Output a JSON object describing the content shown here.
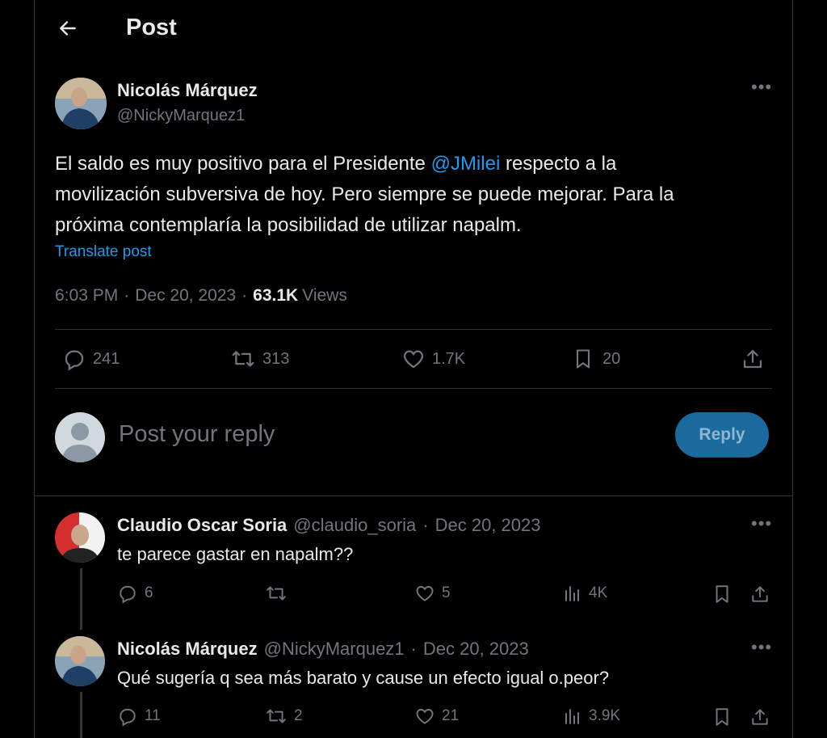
{
  "header": {
    "back_icon": "arrow-left-icon",
    "title": "Post"
  },
  "post": {
    "author_name": "Nicolás Márquez",
    "author_handle": "@NickyMarquez1",
    "text_line1_pre": "El saldo es muy positivo para el Presidente ",
    "mention": "@JMilei",
    "text_line1_post": " respecto a la",
    "text_line2": "movilización subversiva de hoy. Pero siempre se puede mejorar. Para la",
    "text_line3": "próxima contemplaría la posibilidad de utilizar napalm.",
    "translate": "Translate post",
    "time": "6:03 PM",
    "sep": "·",
    "date": "Dec 20, 2023",
    "views_count": "63.1K",
    "views_label": "Views",
    "stats": {
      "replies": "241",
      "reposts": "313",
      "likes": "1.7K",
      "bookmarks": "20"
    }
  },
  "composer": {
    "placeholder": "Post your reply",
    "reply_label": "Reply"
  },
  "replies": [
    {
      "name": "Claudio Oscar Soria",
      "handle": "@claudio_soria",
      "sep": "·",
      "date": "Dec 20, 2023",
      "text": "te parece gastar en napalm??",
      "stats": {
        "replies": "6",
        "reposts": "",
        "likes": "5",
        "views": "4K"
      }
    },
    {
      "name": "Nicolás Márquez",
      "handle": "@NickyMarquez1",
      "sep": "·",
      "date": "Dec 20, 2023",
      "text": "Qué sugería q sea más barato y cause un efecto igual o.peor?",
      "stats": {
        "replies": "11",
        "reposts": "2",
        "likes": "21",
        "views": "3.9K"
      }
    }
  ],
  "colors": {
    "accent": "#1d9bf0",
    "reply_button_bg": "#1a6a9e",
    "muted": "#71767b",
    "divider": "#2f3336"
  }
}
